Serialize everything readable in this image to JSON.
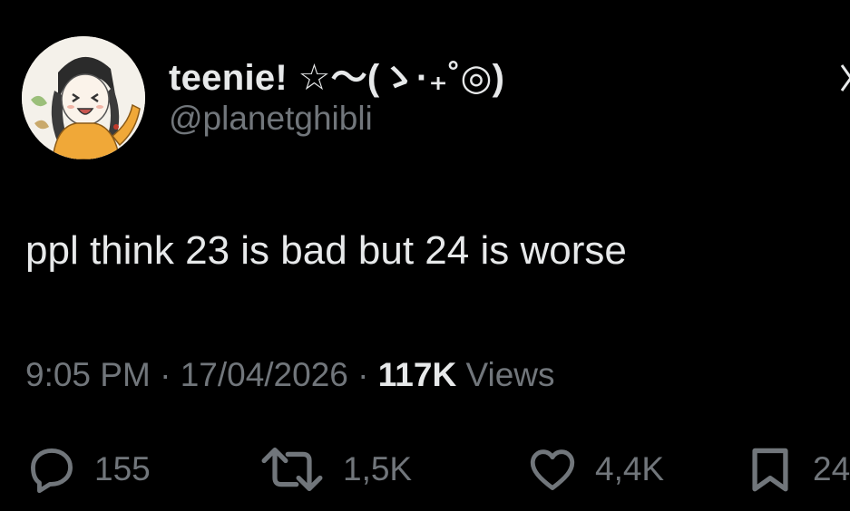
{
  "author": {
    "display_name": "teenie! ☆〜(ゝ·₊˚◎)",
    "handle": "@planetghibli",
    "avatar_icon": "anime-girl-avatar-icon"
  },
  "tweet": {
    "text": "ppl think 23 is bad but 24 is worse",
    "time": "9:05 PM",
    "separator": "·",
    "date": "17/04/2026",
    "views_count": "117K",
    "views_label": "Views"
  },
  "actions": {
    "replies": "155",
    "reposts": "1,5K",
    "likes": "4,4K",
    "bookmarks": "24"
  },
  "colors": {
    "background": "#000000",
    "primary_text": "#e7e9ea",
    "secondary_text": "#71767b"
  }
}
